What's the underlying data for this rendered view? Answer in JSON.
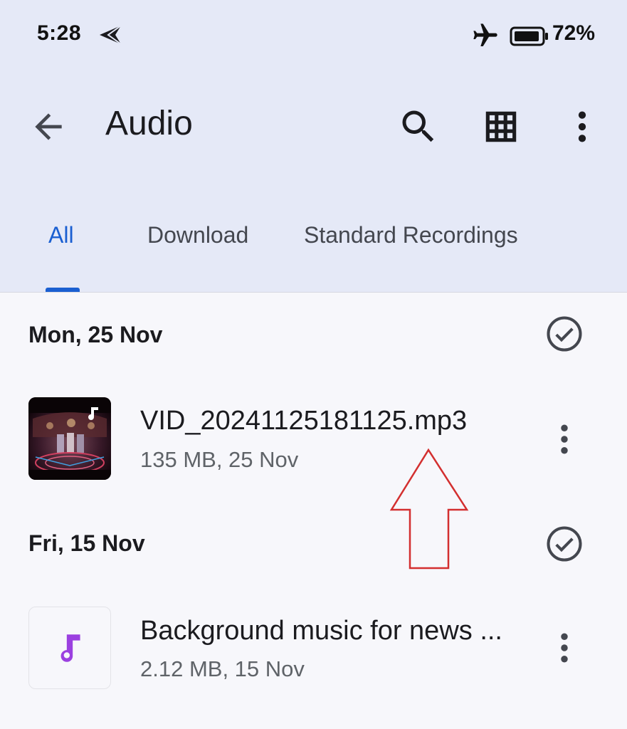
{
  "status_bar": {
    "time": "5:28",
    "battery_percent": "72%",
    "icons": [
      "nav-arrow-icon",
      "airplane-icon",
      "battery-icon"
    ]
  },
  "app_bar": {
    "title": "Audio",
    "icons": [
      "back-icon",
      "search-icon",
      "grid-view-icon",
      "more-options-icon"
    ]
  },
  "tabs": [
    {
      "label": "All",
      "selected": true
    },
    {
      "label": "Download",
      "selected": false
    },
    {
      "label": "Standard Recordings",
      "selected": false
    }
  ],
  "groups": [
    {
      "date": "Mon, 25 Nov",
      "files": [
        {
          "name": "VID_20241125181125.mp3",
          "meta": "135 MB, 25 Nov",
          "thumbnail": "video-thumbnail"
        }
      ]
    },
    {
      "date": "Fri, 15 Nov",
      "files": [
        {
          "name": "Background music for news ...",
          "meta": "2.12 MB, 15 Nov",
          "thumbnail": "music-note-icon"
        }
      ]
    }
  ],
  "colors": {
    "header_bg": "#e5e9f7",
    "accent": "#1a5fd1",
    "annotation_arrow": "#d32f2f",
    "music_icon": "#9b40e0"
  }
}
